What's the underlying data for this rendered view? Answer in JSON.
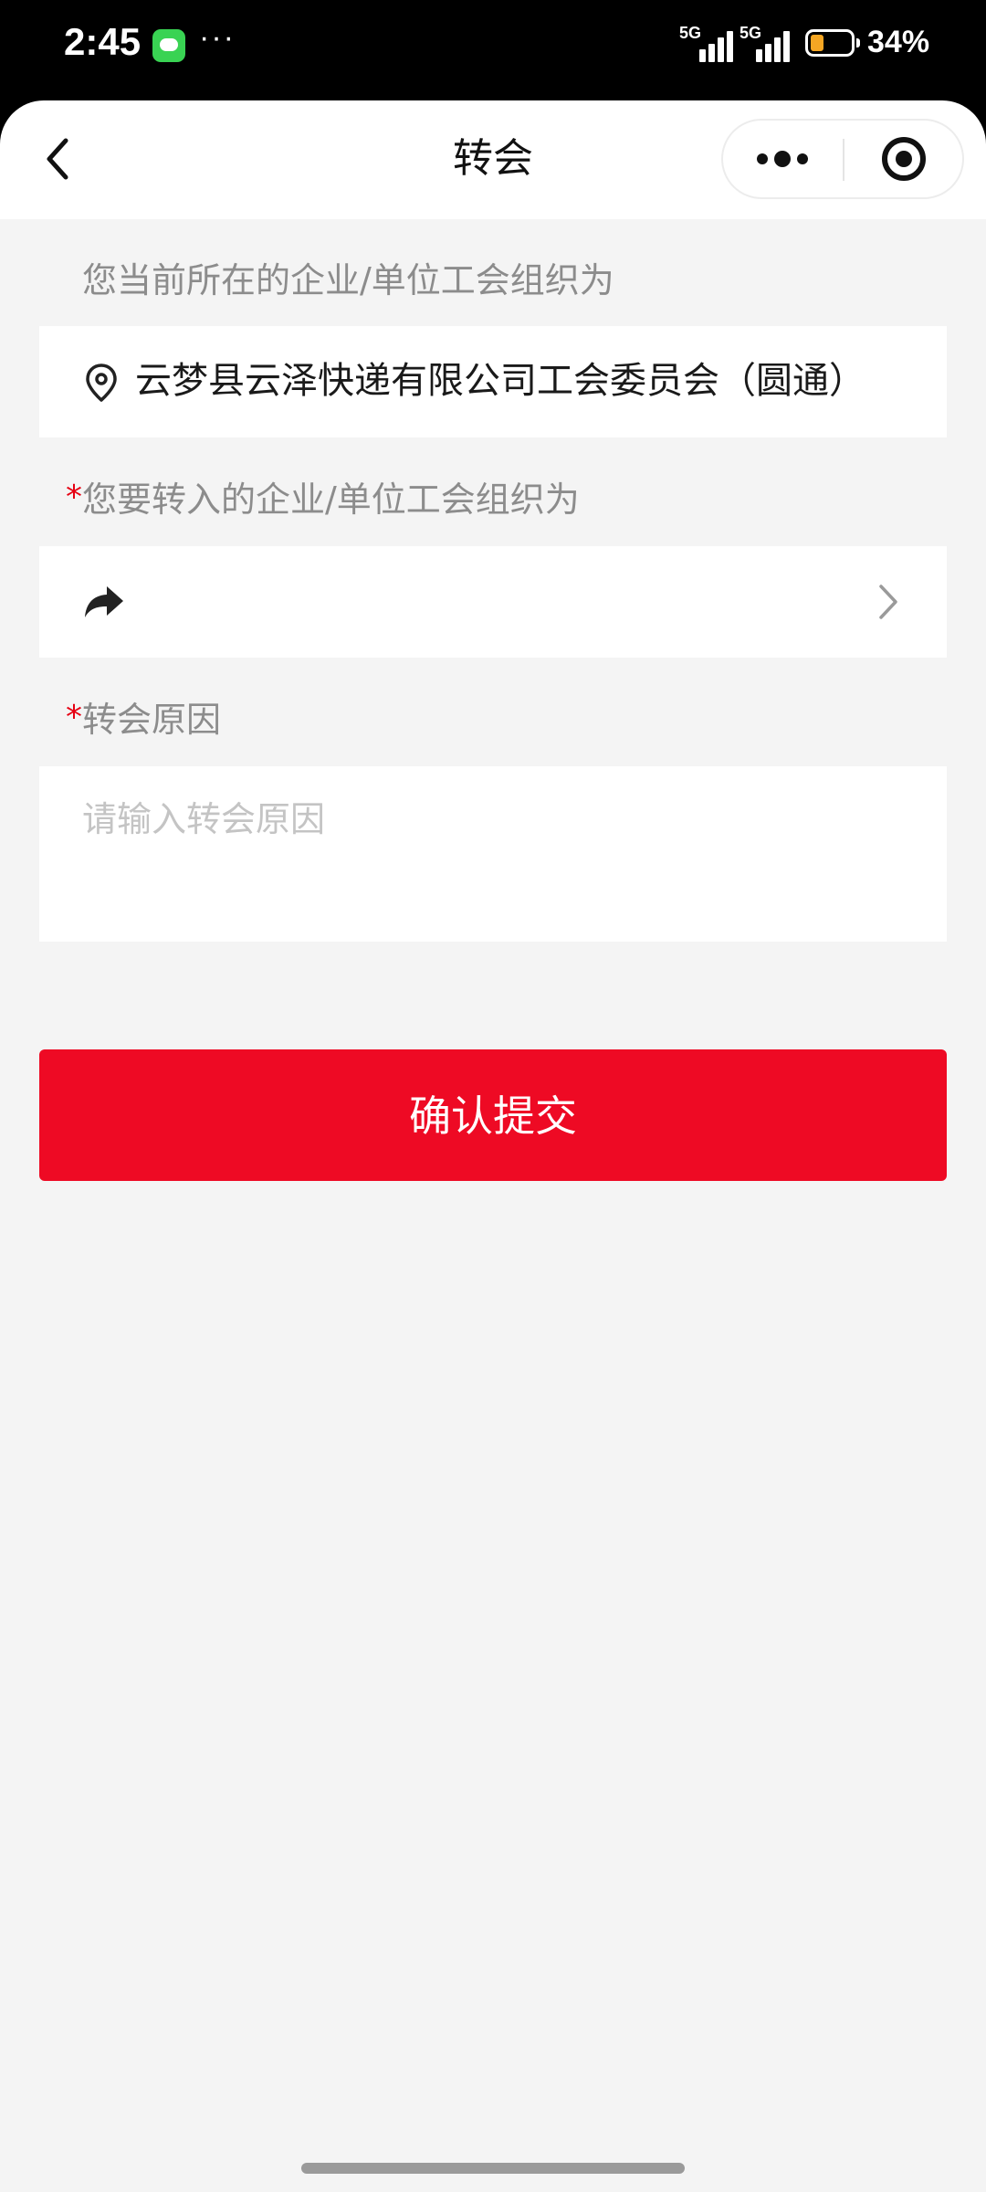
{
  "status_bar": {
    "time": "2:45",
    "dots": "···",
    "network_1": "5G",
    "network_2": "5G",
    "battery_percent_text": "34%",
    "battery_level": 0.34,
    "battery_color": "#f5a623",
    "message_icon": "message-icon"
  },
  "header": {
    "title": "转会",
    "back_icon": "chevron-left-icon",
    "more_icon": "more-dots-icon",
    "close_icon": "target-circle-icon"
  },
  "form": {
    "current_label": "您当前所在的企业/单位工会组织为",
    "current_value": "云梦县云泽快递有限公司工会委员会（圆通）",
    "current_icon": "location-pin-icon",
    "target_required": "*",
    "target_label": "您要转入的企业/单位工会组织为",
    "target_value": "",
    "target_icon": "share-forward-icon",
    "reason_required": "*",
    "reason_label": "转会原因",
    "reason_placeholder": "请输入转会原因",
    "reason_value": ""
  },
  "submit": {
    "label": "确认提交",
    "color": "#ee0a24"
  }
}
